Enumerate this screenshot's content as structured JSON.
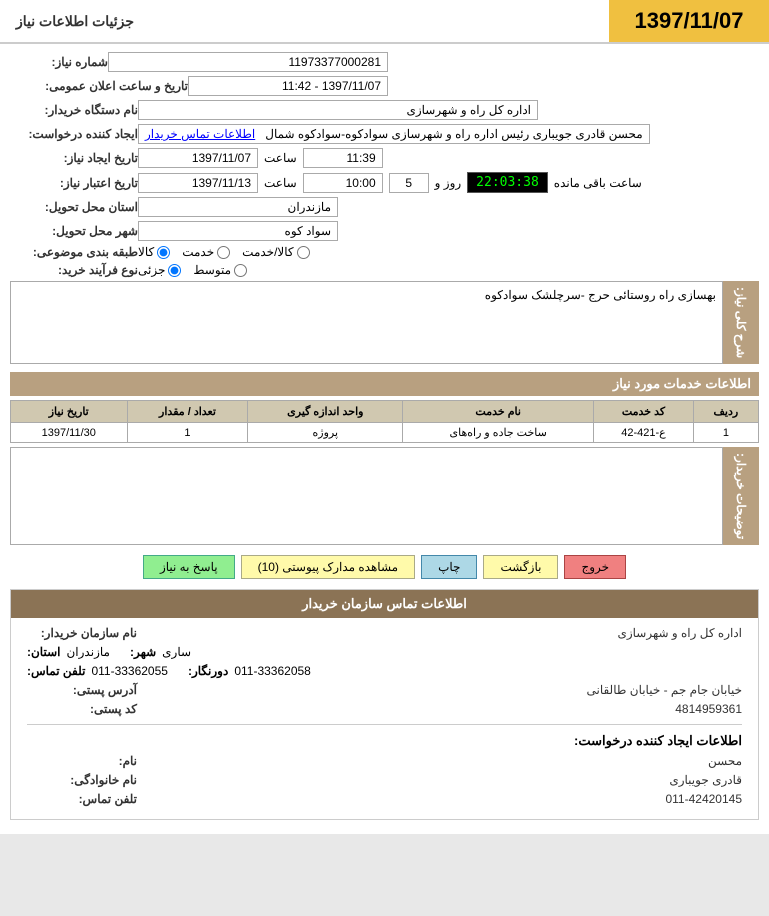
{
  "header": {
    "date": "1397/11/07",
    "title": "جزئیات اطلاعات نیاز"
  },
  "form": {
    "shomara_label": "شماره نیاز:",
    "shomara_value": "11973377000281",
    "tarikh_label": "تاریخ و ساعت اعلان عمومی:",
    "tarikh_value": "1397/11/07 - 11:42",
    "nam_dastgah_label": "نام دستگاه خریدار:",
    "nam_dastgah_value": "اداره کل راه و شهرسازی",
    "ijad_label": "ایجاد کننده درخواست:",
    "ijad_value": "محسن قادری جویباری رئیس اداره راه و شهرسازی سوادکوه-سوادکوه شمال",
    "ijad_link": "اطلاعات تماس خریدار",
    "tarikh_ijad_label": "تاریخ ایجاد نیاز:",
    "tarikh_ijad_date": "1397/11/07",
    "tarikh_ijad_time_label": "ساعت",
    "tarikh_ijad_time": "11:39",
    "tarikh_etebar_label": "تاریخ اعتبار نیاز:",
    "tarikh_etebar_date": "1397/11/13",
    "tarikh_etebar_time_label": "ساعت",
    "tarikh_etebar_time": "10:00",
    "saat_baqi_label": "ساعت باقی مانده",
    "timer_value": "22:03:38",
    "roz_label": "روز و",
    "roz_value": "5",
    "ostan_label": "استان محل تحویل:",
    "ostan_value": "مازندران",
    "shahr_label": "شهر محل تحویل:",
    "shahr_value": "سواد کوه",
    "tabaqe_label": "طبقه بندی موضوعی:",
    "radio_kala": "کالا",
    "radio_khedmat": "خدمت",
    "radio_kala_khedmat": "کالا/خدمت",
    "radio_jozi": "جزئی",
    "radio_motavasset": "متوسط",
    "nooe_farayand_label": "نوع فرآیند خرید:"
  },
  "sharh": {
    "section_label": "شرح کلی نیاز:",
    "value": "بهسازی راه روستائی حرج -سرچلشک سوادکوه"
  },
  "khadamat": {
    "section_label": "اطلاعات خدمات مورد نیاز",
    "table": {
      "headers": [
        "ردیف",
        "کد خدمت",
        "نام خدمت",
        "واحد اندازه گیری",
        "تعداد / مقدار",
        "تاریخ نیاز"
      ],
      "rows": [
        {
          "radif": "1",
          "kod": "ع-421-42",
          "nam": "ساخت جاده و راه‌های",
          "vahed": "پروژه",
          "tedad": "1",
          "tarikh": "1397/11/30"
        }
      ]
    }
  },
  "tozih": {
    "label": "توضیحات\nخریدار:",
    "value": ""
  },
  "buttons": {
    "pasokh": "پاسخ به نیاز",
    "moshahed": "مشاهده مدارک پیوستی (10)",
    "chap": "چاپ",
    "bazgasht": "بازگشت",
    "khoroj": "خروج"
  },
  "contact": {
    "section_label": "اطلاعات تماس سازمان خریدار",
    "nam_sazman_label": "نام سازمان خریدار:",
    "nam_sazman_value": "اداره کل راه و شهرسازی",
    "ostan_label": "استان:",
    "ostan_value": "مازندران",
    "shahr_label": "شهر:",
    "shahr_value": "ساری",
    "telefon_label": "تلفن تماس:",
    "telefon_value": "011-33362055",
    "doornegar_label": "دورنگار:",
    "doornegar_value": "011-33362058",
    "address_label": "آدرس پستی:",
    "address_value": "خیابان جام جم - خیابان طالقانی",
    "kodpost_label": "کد پستی:",
    "kodpost_value": "4814959361",
    "requester_section_label": "اطلاعات ایجاد کننده درخواست:",
    "nam_label": "نام:",
    "nam_value": "محسن",
    "namkhanevadegi_label": "نام خانوادگی:",
    "namkhanevadegi_value": "قادری جویباری",
    "telefon2_label": "تلفن تماس:",
    "telefon2_value": "011-42420145"
  }
}
